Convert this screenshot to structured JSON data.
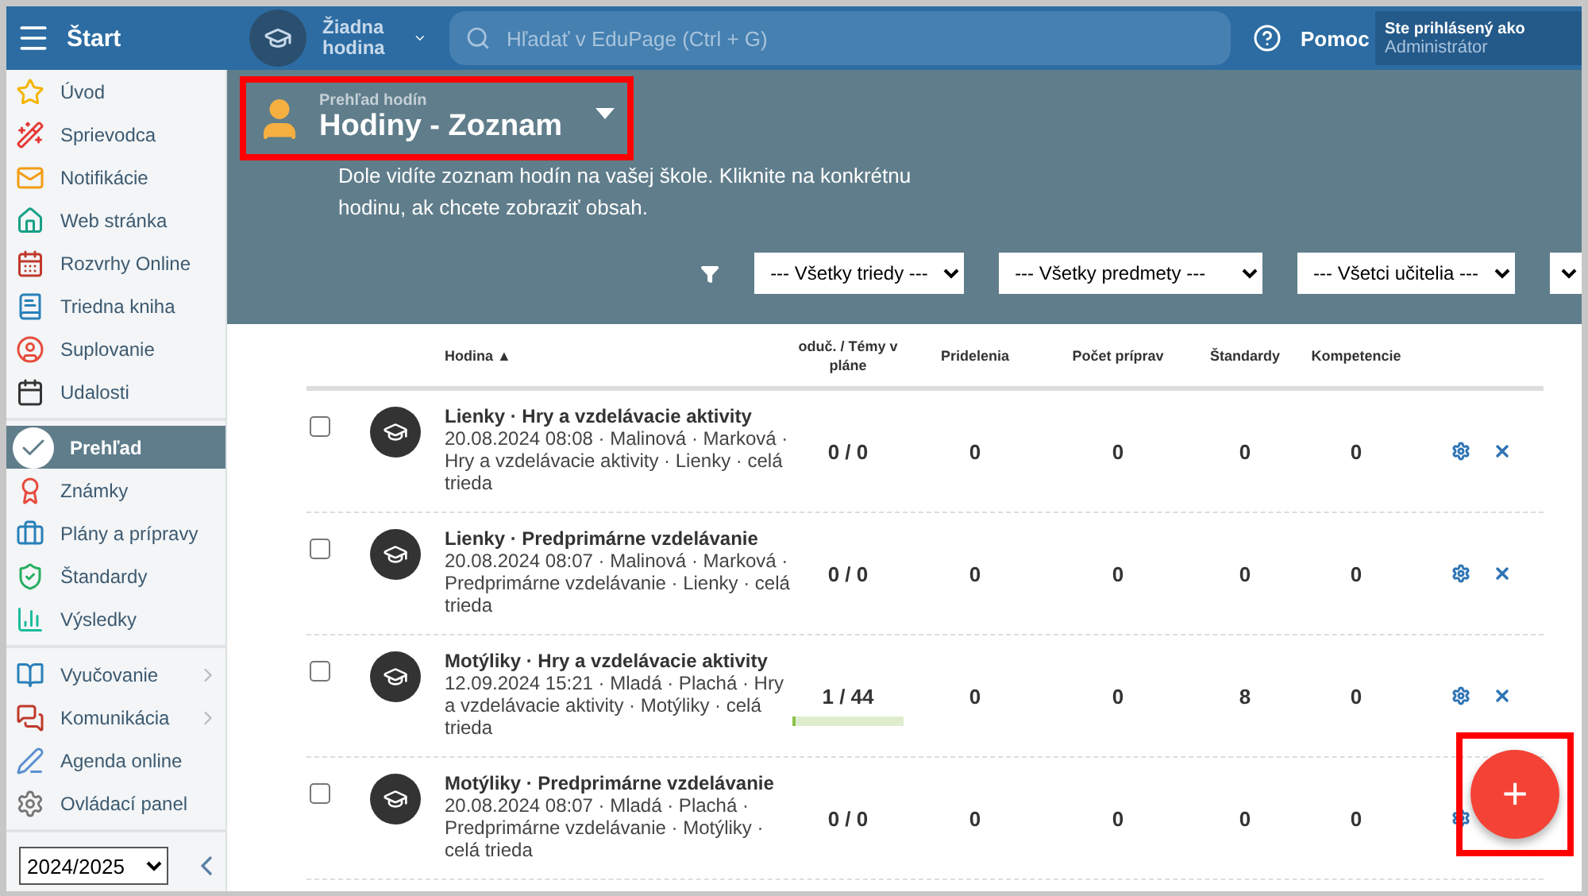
{
  "topbar": {
    "menu_label": "Štart",
    "lesson_selector": "Žiadna hodina",
    "search": {
      "placeholder": "Hľadať v EduPage (Ctrl + G)"
    },
    "help": "Pomoc",
    "user": {
      "caption": "Ste prihlásený ako",
      "name": "Administrátor"
    }
  },
  "sidebar": {
    "sections": [
      [
        {
          "label": "Úvod",
          "selected": false,
          "submenu": false
        },
        {
          "label": "Sprievodca",
          "selected": false,
          "submenu": false
        },
        {
          "label": "Notifikácie",
          "selected": false,
          "submenu": false
        },
        {
          "label": "Web stránka",
          "selected": false,
          "submenu": false
        },
        {
          "label": "Rozvrhy Online",
          "selected": false,
          "submenu": false
        },
        {
          "label": "Triedna kniha",
          "selected": false,
          "submenu": false
        },
        {
          "label": "Suplovanie",
          "selected": false,
          "submenu": false
        },
        {
          "label": "Udalosti",
          "selected": false,
          "submenu": false
        }
      ],
      [
        {
          "label": "Prehľad",
          "selected": true,
          "submenu": false
        },
        {
          "label": "Známky",
          "selected": false,
          "submenu": false
        },
        {
          "label": "Plány a prípravy",
          "selected": false,
          "submenu": false
        },
        {
          "label": "Štandardy",
          "selected": false,
          "submenu": false
        },
        {
          "label": "Výsledky",
          "selected": false,
          "submenu": false
        }
      ],
      [
        {
          "label": "Vyučovanie",
          "selected": false,
          "submenu": true
        },
        {
          "label": "Komunikácia",
          "selected": false,
          "submenu": true
        },
        {
          "label": "Agenda online",
          "selected": false,
          "submenu": false
        },
        {
          "label": "Ovládací panel",
          "selected": false,
          "submenu": false
        }
      ]
    ],
    "year_select": "2024/2025"
  },
  "page_header": {
    "subtitle": "Prehľad hodín",
    "title": "Hodiny - Zoznam",
    "highlighted": true,
    "description": "Dole vidíte zoznam hodín na vašej škole. Kliknite na konkrétnu hodinu, ak chcete zobraziť obsah."
  },
  "filters": [
    "--- Všetky triedy ---",
    "--- Všetky predmety ---",
    "--- Všetci učitelia ---"
  ],
  "table": {
    "columns": [
      "Hodina ▲",
      "oduč. / Témy v pláne",
      "Pridelenia",
      "Počet príprav",
      "Štandardy",
      "Kompetencie"
    ],
    "rows": [
      {
        "checked": false,
        "title": "Lienky · Hry a vzdelávacie aktivity",
        "details": "20.08.2024 08:08 · Malinová · Marková · Hry a vzdelávacie aktivity · Lienky · celá trieda",
        "topics": "0 / 0",
        "assignments": "0",
        "preparations": "0",
        "standards": "0",
        "competences": "0"
      },
      {
        "checked": false,
        "title": "Lienky · Predprimárne vzdelávanie",
        "details": "20.08.2024 08:07 · Malinová · Marková · Predprimárne vzdelávanie · Lienky · celá trieda",
        "topics": "0 / 0",
        "assignments": "0",
        "preparations": "0",
        "standards": "0",
        "competences": "0"
      },
      {
        "checked": false,
        "title": "Motýliky · Hry a vzdelávacie aktivity",
        "details": "12.09.2024 15:21 · Mladá · Plachá · Hry a vzdelávacie aktivity · Motýliky · celá trieda",
        "topics": "1 / 44",
        "level": 0.023,
        "assignments": "0",
        "preparations": "0",
        "standards": "8",
        "competences": "0"
      },
      {
        "checked": false,
        "title": "Motýliky · Predprimárne vzdelávanie",
        "details": "20.08.2024 08:07 · Mladá · Plachá · Predprimárne vzdelávanie · Motýliky · celá trieda",
        "topics": "0 / 0",
        "assignments": "0",
        "preparations": "0",
        "standards": "0",
        "competences": "0"
      }
    ]
  },
  "add_button": {
    "label": "+",
    "highlighted": true
  }
}
